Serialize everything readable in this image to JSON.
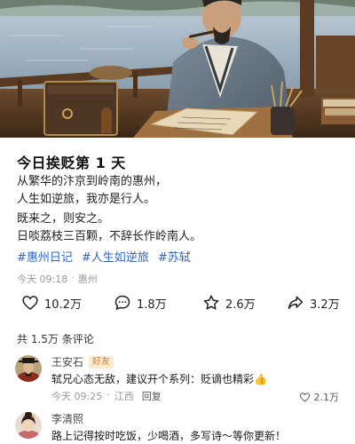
{
  "post": {
    "title": "今日挨贬第 1 天",
    "lines": [
      "从繁华的汴京到岭南的惠州，",
      "人生如逆旅，我亦是行人。",
      "既来之，则安之。",
      "日啖荔枝三百颗，不辞长作岭南人。"
    ],
    "tags": [
      "#惠州日记",
      "#人生如逆旅",
      "#苏轼"
    ],
    "time": "今天 09:18",
    "location": "惠州"
  },
  "stats": {
    "likes": "10.2万",
    "comments": "1.8万",
    "favorites": "2.6万",
    "shares": "3.2万"
  },
  "comments_header": "共 1.5万 条评论",
  "comments": [
    {
      "name": "王安石",
      "badge": "好友",
      "text": "轼兄心态无敌，建议开个系列：贬谪也精彩👍",
      "time": "今天 09:25",
      "location": "江西",
      "reply": "回复",
      "likes": "2.1万"
    },
    {
      "name": "李清照",
      "text": "路上记得按时吃饭，少喝酒，多写诗～等你更新！"
    }
  ],
  "icons": {
    "like": "heart-icon",
    "comment": "chat-bubble-icon",
    "favorite": "star-icon",
    "share": "share-arrow-icon"
  },
  "colors": {
    "tag": "#2f64c8",
    "badge_text": "#d8822a",
    "badge_bg": "#fde9cf",
    "meta": "#9a9a9a"
  }
}
